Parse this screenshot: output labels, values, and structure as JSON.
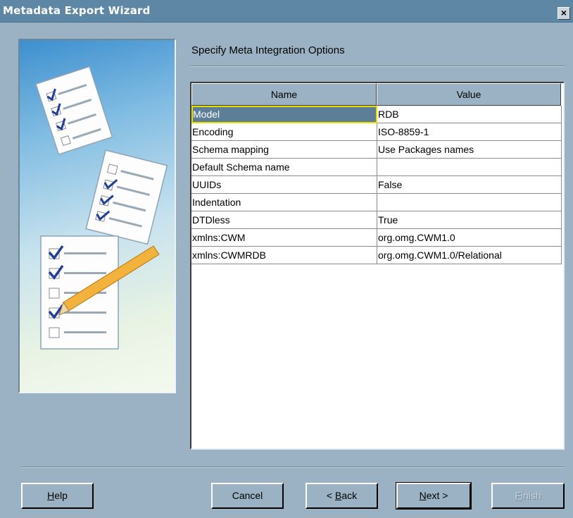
{
  "window": {
    "title": "Metadata Export Wizard",
    "close_glyph": "×"
  },
  "page": {
    "heading": "Specify Meta Integration Options"
  },
  "grid": {
    "columns": {
      "name": "Name",
      "value": "Value"
    },
    "rows": [
      {
        "name": "Model",
        "value": "RDB"
      },
      {
        "name": "Encoding",
        "value": "ISO-8859-1"
      },
      {
        "name": "Schema mapping",
        "value": "Use Packages names"
      },
      {
        "name": "Default Schema name",
        "value": ""
      },
      {
        "name": "UUIDs",
        "value": "False"
      },
      {
        "name": "Indentation",
        "value": ""
      },
      {
        "name": "DTDless",
        "value": "True"
      },
      {
        "name": "xmlns:CWM",
        "value": "org.omg.CWM1.0"
      },
      {
        "name": "xmlns:CWMRDB",
        "value": "org.omg.CWM1.0/Relational"
      }
    ]
  },
  "buttons": {
    "help": {
      "mnemonic": "H",
      "rest": "elp"
    },
    "cancel": {
      "label": "Cancel"
    },
    "back": {
      "pre": "< ",
      "mnemonic": "B",
      "rest": "ack"
    },
    "next": {
      "mnemonic": "N",
      "rest": "ext >"
    },
    "finish": {
      "mnemonic": "F",
      "rest": "inish"
    }
  },
  "colors": {
    "dialog_bg": "#9ab2c3",
    "titlebar": "#5e87a6",
    "selected_cell": "#5c7f97",
    "focus_border": "#e9e000"
  }
}
